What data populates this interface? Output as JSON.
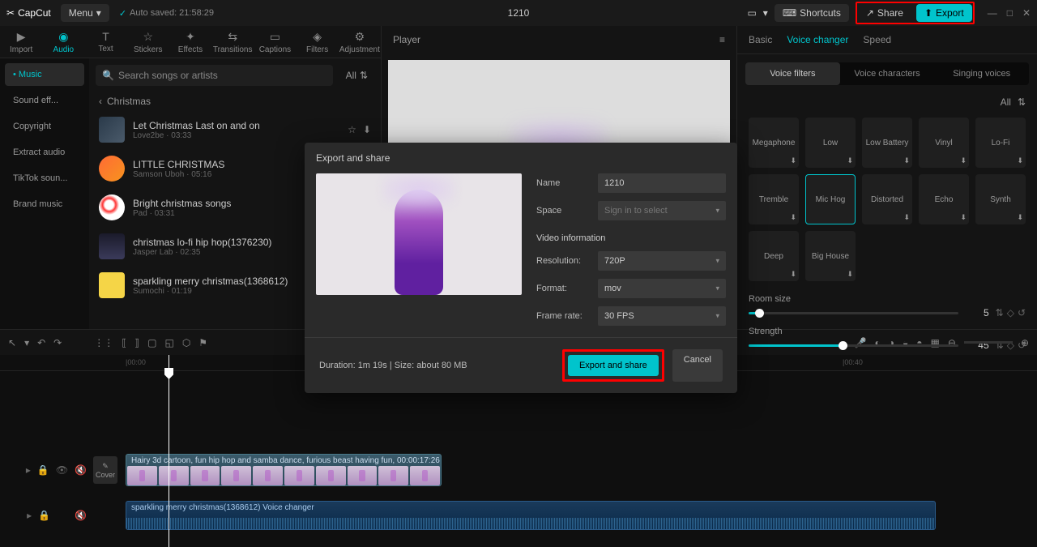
{
  "app": {
    "name": "CapCut",
    "menu": "Menu",
    "autosave": "Auto saved: 21:58:29",
    "title": "1210"
  },
  "topbar": {
    "shortcuts": "Shortcuts",
    "share": "Share",
    "export": "Export"
  },
  "tabs": [
    "Import",
    "Audio",
    "Text",
    "Stickers",
    "Effects",
    "Transitions",
    "Captions",
    "Filters",
    "Adjustment"
  ],
  "sidebar": [
    "Music",
    "Sound eff...",
    "Copyright",
    "Extract audio",
    "TikTok soun...",
    "Brand music"
  ],
  "search": {
    "placeholder": "Search songs or artists",
    "filter": "All"
  },
  "breadcrumb": "Christmas",
  "songs": [
    {
      "title": "Let Christmas Last on and on",
      "meta": "Love2be · 03:33"
    },
    {
      "title": "LITTLE CHRISTMAS",
      "meta": "Samson Uboh · 05:16"
    },
    {
      "title": "Bright christmas songs",
      "meta": "Pad · 03:31"
    },
    {
      "title": "christmas lo-fi hip hop(1376230)",
      "meta": "Jasper Lab · 02:35"
    },
    {
      "title": "sparkling merry christmas(1368612)",
      "meta": "Sumochi · 01:19"
    }
  ],
  "player": {
    "label": "Player"
  },
  "right": {
    "tabs": [
      "Basic",
      "Voice changer",
      "Speed"
    ],
    "subtabs": [
      "Voice filters",
      "Voice characters",
      "Singing voices"
    ],
    "filter": "All",
    "voices": [
      "Megaphone",
      "Low",
      "Low Battery",
      "Vinyl",
      "Lo-Fi",
      "Tremble",
      "Mic Hog",
      "Distorted",
      "Echo",
      "Synth",
      "Deep",
      "Big House"
    ],
    "roomsize": {
      "label": "Room size",
      "value": "5"
    },
    "strength": {
      "label": "Strength",
      "value": "45"
    }
  },
  "timeline": {
    "marks": [
      "|00:00",
      "|00:40"
    ],
    "video_label": "Hairy 3d cartoon, fun hip hop and samba dance, furious beast having fun,   00:00:17:26",
    "cover": "Cover",
    "audio_label": "sparkling merry christmas(1368612)     Voice changer"
  },
  "modal": {
    "title": "Export and share",
    "name_label": "Name",
    "name_value": "1210",
    "space_label": "Space",
    "space_value": "Sign in to select",
    "section": "Video information",
    "res_label": "Resolution:",
    "res_value": "720P",
    "fmt_label": "Format:",
    "fmt_value": "mov",
    "fps_label": "Frame rate:",
    "fps_value": "30 FPS",
    "info": "Duration: 1m 19s | Size: about 80 MB",
    "primary": "Export and share",
    "cancel": "Cancel"
  }
}
